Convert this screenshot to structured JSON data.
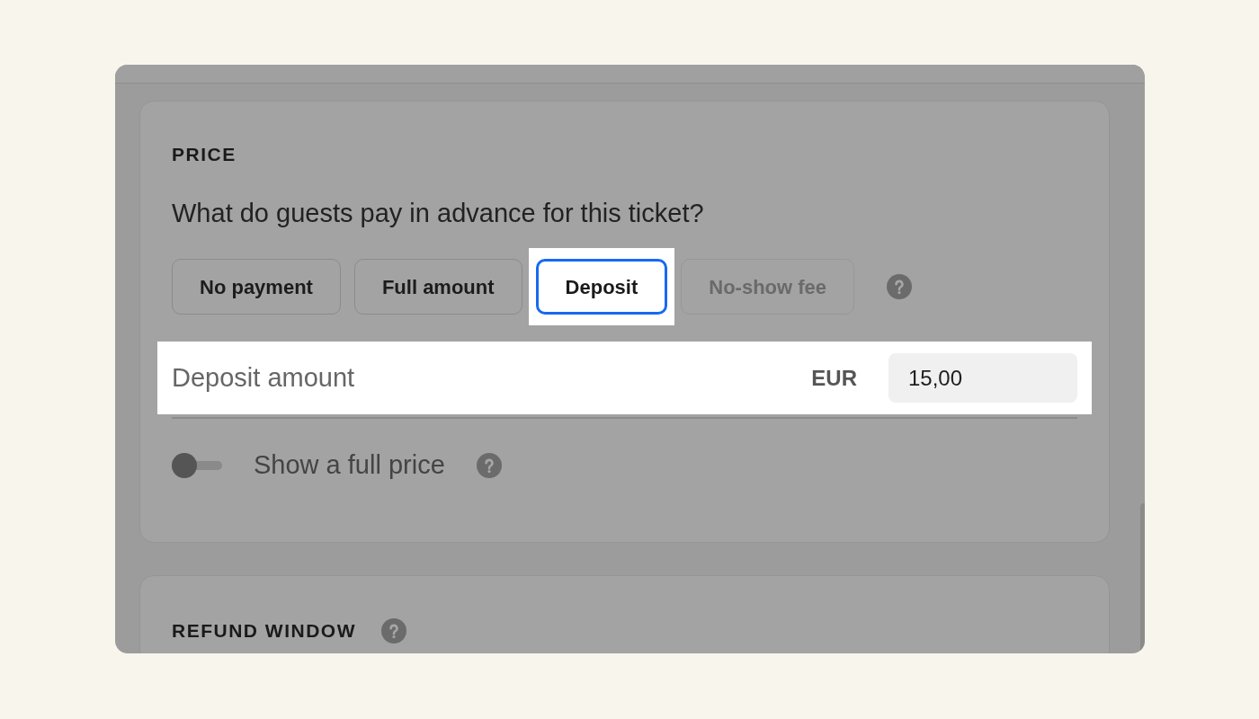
{
  "price_card": {
    "heading": "PRICE",
    "question": "What do guests pay in advance for this ticket?",
    "options": [
      {
        "label": "No payment",
        "selected": false,
        "disabled": false,
        "highlighted": false
      },
      {
        "label": "Full amount",
        "selected": false,
        "disabled": false,
        "highlighted": false
      },
      {
        "label": "Deposit",
        "selected": true,
        "disabled": false,
        "highlighted": true
      },
      {
        "label": "No-show fee",
        "selected": false,
        "disabled": true,
        "highlighted": false
      }
    ],
    "deposit_amount": {
      "label": "Deposit amount",
      "currency": "EUR",
      "value": "15,00",
      "highlighted": true
    },
    "full_price_toggle": {
      "label": "Show a full price",
      "on": false
    }
  },
  "refund_card": {
    "heading": "REFUND WINDOW"
  }
}
